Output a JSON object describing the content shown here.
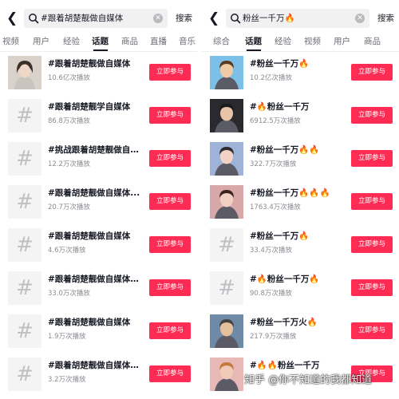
{
  "left": {
    "search": {
      "query": "#跟着胡楚靓做自媒体",
      "button": "搜索"
    },
    "tabs": [
      "视频",
      "用户",
      "经验",
      "话题",
      "商品",
      "直播",
      "音乐"
    ],
    "active_tab": "话题",
    "join_label": "立即参与",
    "rows": [
      {
        "title": "#跟着胡楚靓做自媒体",
        "plays": "10.6亿次播放",
        "thumb": "person"
      },
      {
        "title": "#跟着胡楚靓学自媒体",
        "plays": "86.8万次播放",
        "thumb": "hash"
      },
      {
        "title": "#挑战跟着胡楚靓做自媒...",
        "plays": "12.2万次播放",
        "thumb": "hash"
      },
      {
        "title": "#跟着胡楚靓做自媒体...",
        "plays": "20.7万次播放",
        "thumb": "hash"
      },
      {
        "title": "#跟着胡楚靓做自媒体",
        "plays": "4.6万次播放",
        "thumb": "hash"
      },
      {
        "title": "#跟着胡楚靓做自媒体第...",
        "plays": "33.0万次播放",
        "thumb": "hash"
      },
      {
        "title": "#跟着胡楚靓做自媒体",
        "plays": "1.9万次播放",
        "thumb": "hash"
      },
      {
        "title": "#跟着胡楚靓做自媒体话...",
        "plays": "3.2万次播放",
        "thumb": "hash"
      }
    ]
  },
  "right": {
    "search": {
      "query": "粉丝一千万🔥",
      "button": "搜索"
    },
    "tabs": [
      "综合",
      "话题",
      "经验",
      "视频",
      "用户",
      "商品"
    ],
    "active_tab": "话题",
    "join_label": "立即参与",
    "rows": [
      {
        "title": "#粉丝一千万🔥",
        "plays": "10.2亿次播放",
        "thumb": "photo"
      },
      {
        "title": "#🔥粉丝一千万",
        "plays": "6912.5万次播放",
        "thumb": "photo"
      },
      {
        "title": "#粉丝一千万🔥🔥",
        "plays": "322.7万次播放",
        "thumb": "photo"
      },
      {
        "title": "#粉丝一千万🔥🔥🔥",
        "plays": "1763.4万次播放",
        "thumb": "photo"
      },
      {
        "title": "#粉丝一千万🔥",
        "plays": "33.4万次播放",
        "thumb": "hash"
      },
      {
        "title": "#🔥粉丝一千万🔥",
        "plays": "90.8万次播放",
        "thumb": "hash"
      },
      {
        "title": "#粉丝一千万火🔥",
        "plays": "217.9万次播放",
        "thumb": "photo"
      },
      {
        "title": "#🔥🔥粉丝一千万",
        "plays": "",
        "thumb": "photo"
      }
    ]
  },
  "watermark": "知乎 @你不知道的我都知道",
  "colors": {
    "accent": "#fe2c55",
    "flame": "#ff5b1a",
    "text": "#161823",
    "muted": "#8a8b91",
    "search_bg": "#f1f1f2"
  }
}
